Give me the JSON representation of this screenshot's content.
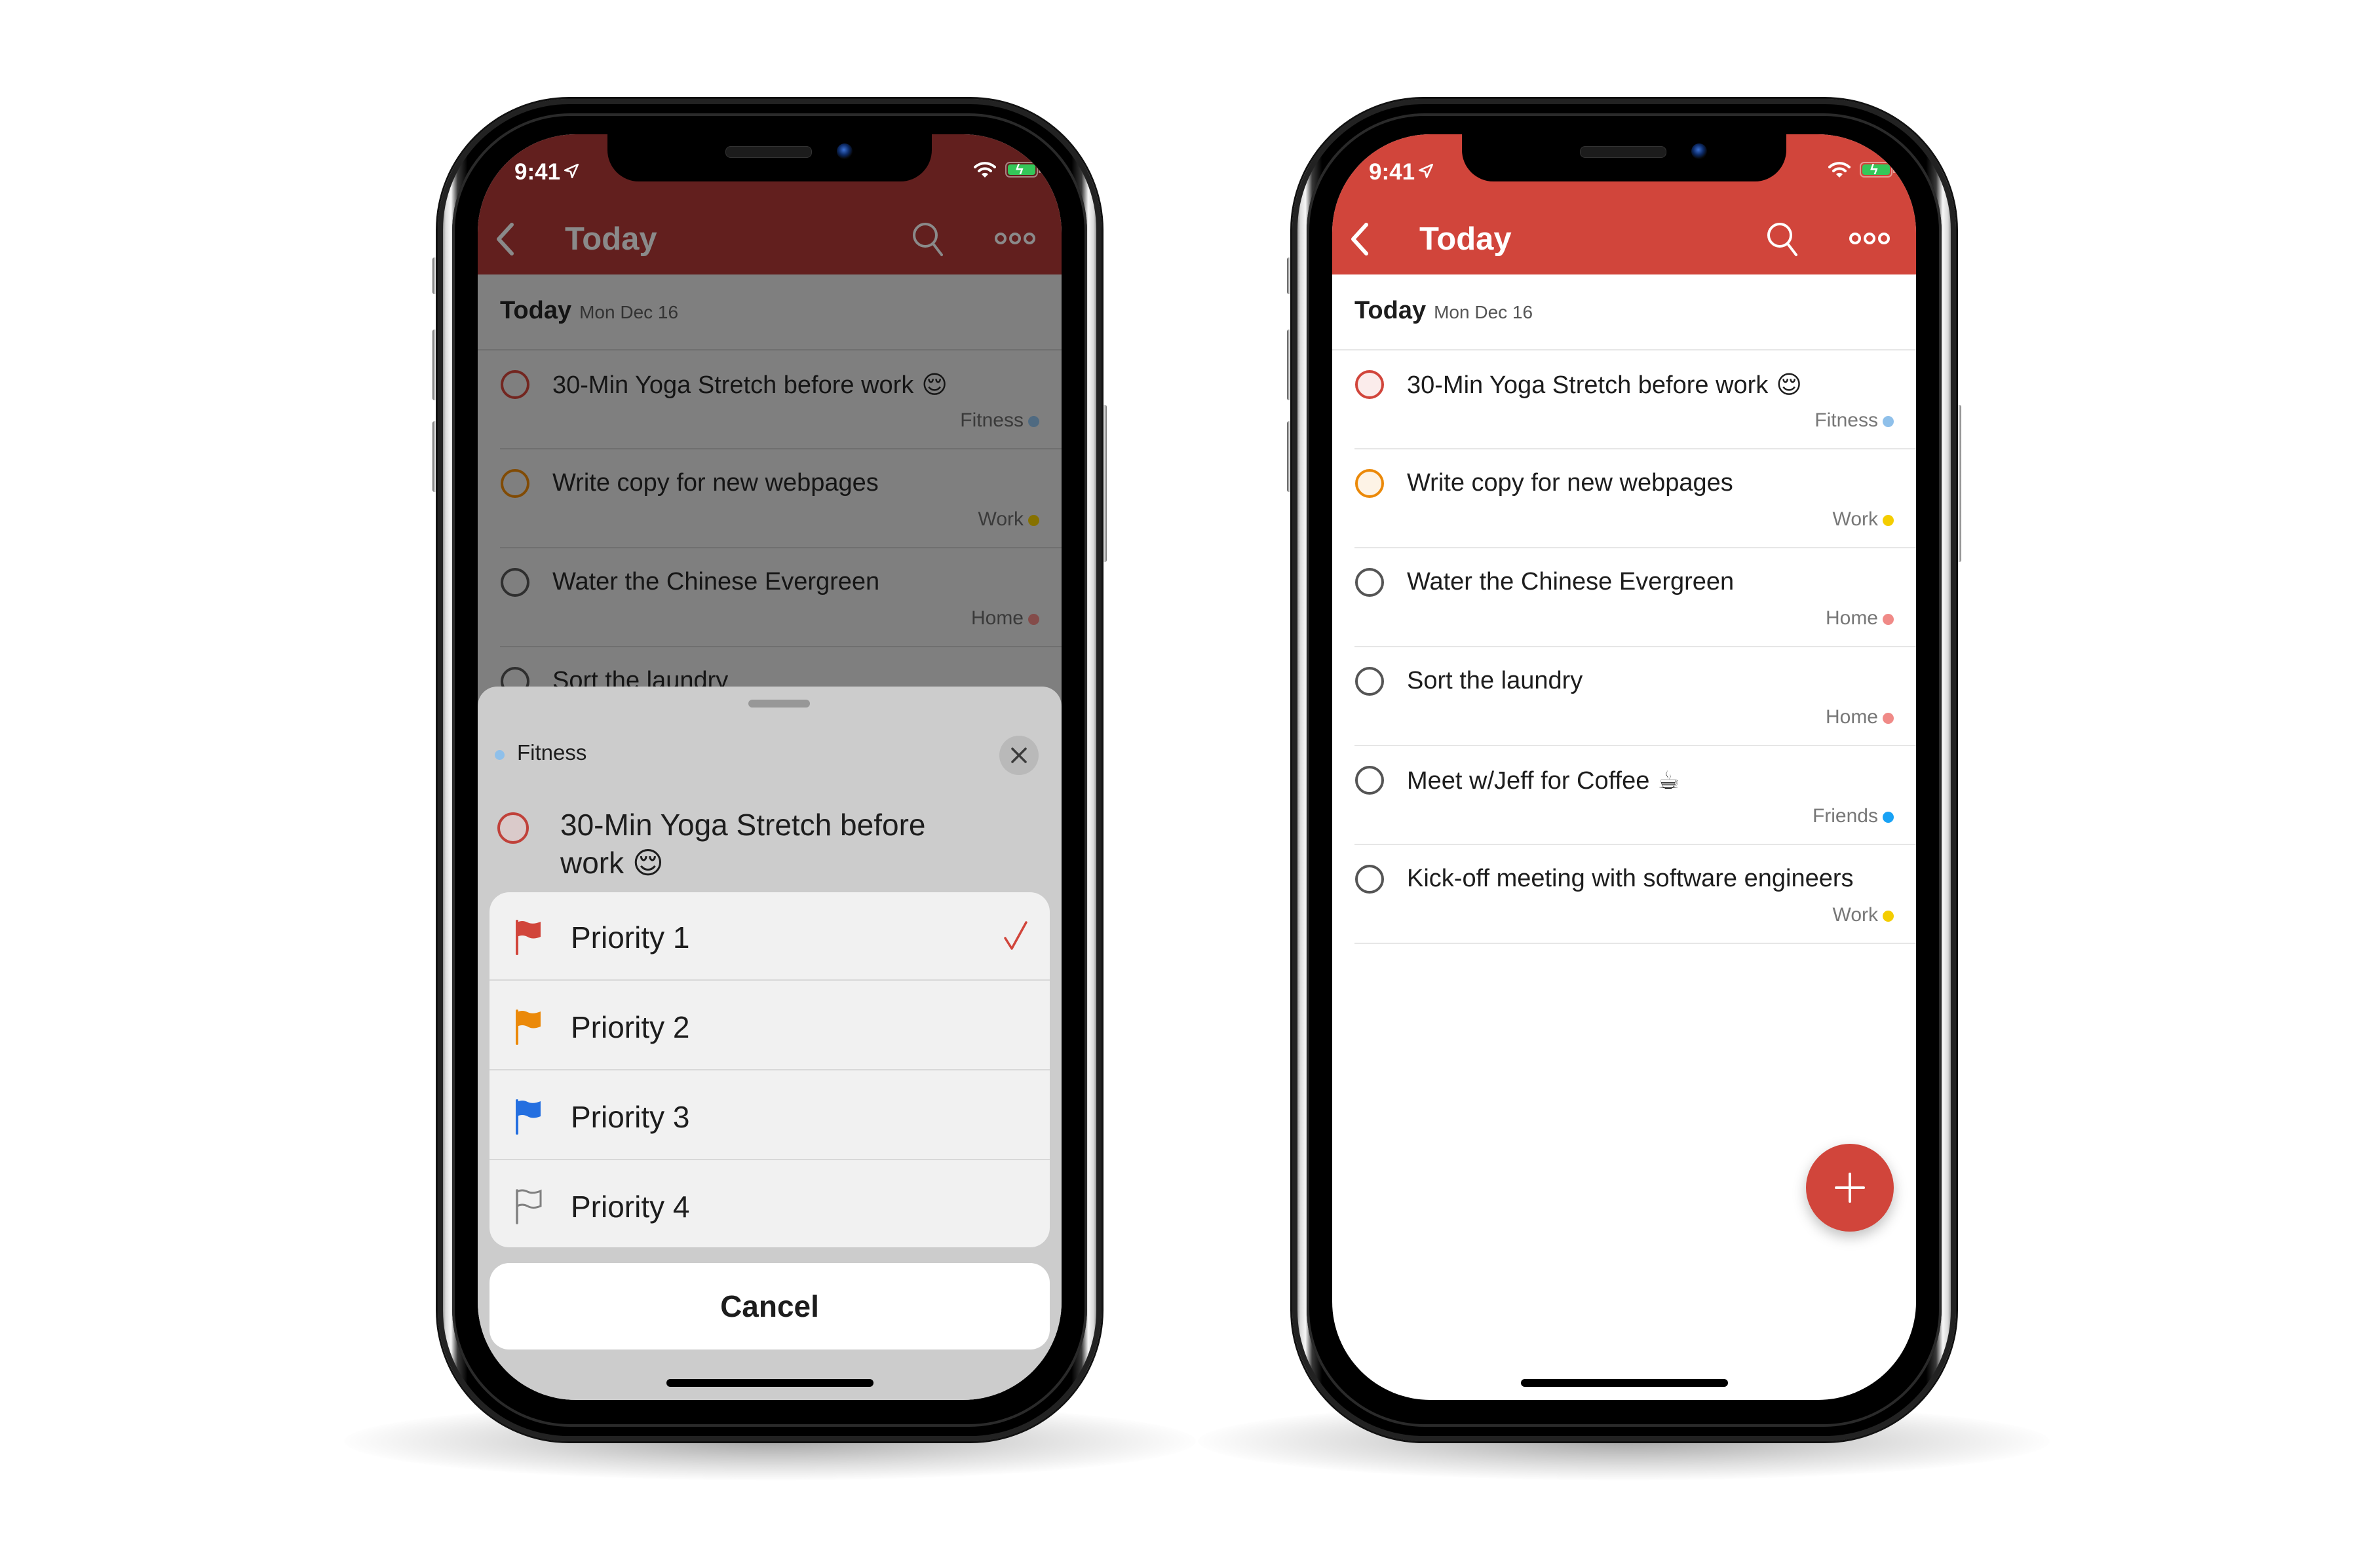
{
  "colors": {
    "brand_red": "#d1453b",
    "brand_red_dimmed": "#621f1e",
    "priority_1": "#d1453b",
    "priority_2": "#eb8909",
    "priority_3": "#246fe0",
    "priority_4": "#808080",
    "project_fitness": "#8fc0ea",
    "project_work": "#f4cd00",
    "project_home": "#f08a87",
    "project_friends": "#19a2f5"
  },
  "status_bar": {
    "time": "9:41",
    "location_icon": "location-arrow-icon",
    "wifi_icon": "wifi-icon",
    "battery_icon": "battery-charging-icon"
  },
  "nav": {
    "title": "Today",
    "back_icon": "chevron-left-icon",
    "search_icon": "search-icon",
    "more_icon": "more-dots-icon"
  },
  "section": {
    "title": "Today",
    "date": "Mon Dec 16"
  },
  "tasks": [
    {
      "title": "30-Min Yoga Stretch before work",
      "emoji": "😌",
      "project": "Fitness",
      "priority": 1
    },
    {
      "title": "Write copy for new webpages",
      "emoji": "",
      "project": "Work",
      "priority": 2
    },
    {
      "title": "Water the Chinese Evergreen",
      "emoji": "",
      "project": "Home",
      "priority": 4
    },
    {
      "title": "Sort the laundry",
      "emoji": "",
      "project": "Home",
      "priority": 4
    },
    {
      "title": "Meet w/Jeff for Coffee",
      "emoji": "☕",
      "project": "Friends",
      "priority": 4
    },
    {
      "title": "Kick-off meeting with software engineers",
      "emoji": "",
      "project": "Work",
      "priority": 4
    }
  ],
  "left_phone": {
    "visible_task_count": 4,
    "priority_sheet": {
      "project": "Fitness",
      "task_title": "30-Min Yoga Stretch before work",
      "task_emoji": "😌",
      "close_icon": "close-icon",
      "options": [
        {
          "label": "Priority 1",
          "icon": "flag-filled-icon",
          "selected": true
        },
        {
          "label": "Priority 2",
          "icon": "flag-filled-icon",
          "selected": false
        },
        {
          "label": "Priority 3",
          "icon": "flag-filled-icon",
          "selected": false
        },
        {
          "label": "Priority 4",
          "icon": "flag-outline-icon",
          "selected": false
        }
      ],
      "cancel_label": "Cancel"
    }
  },
  "right_phone": {
    "fab_icon": "plus-icon"
  }
}
